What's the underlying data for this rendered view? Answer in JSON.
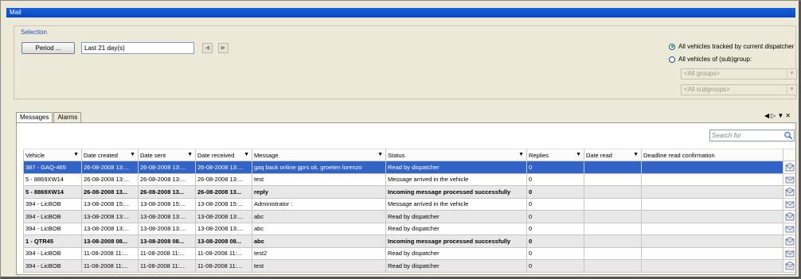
{
  "window": {
    "title": "Mail"
  },
  "selection": {
    "title": "Selection",
    "period_button": "Period ...",
    "period_value": "Last 21 day(s)",
    "radio_all_tracked": "All vehicles tracked by current dispatcher",
    "radio_subgroup": "All vehicles of (sub)group:",
    "groups_combo": "<All groups>",
    "subgroups_combo": "<All subgroups>"
  },
  "tabs": [
    {
      "label": "Messages",
      "active": true
    },
    {
      "label": "Alarms",
      "active": false
    }
  ],
  "search": {
    "placeholder": "Search for"
  },
  "table": {
    "columns": [
      "Vehicle",
      "Date created",
      "Date sent",
      "Date received",
      "Message",
      "Status",
      "Replies",
      "Date read",
      "Deadline read confirmation"
    ],
    "rows": [
      {
        "style": "sel",
        "cells": [
          "387 - GAQ-465",
          "26-08-2008 13:...",
          "26-08-2008 13:...",
          "26-08-2008 13:...",
          "gaq back online  gprs ok. groeten lorenzo",
          "Read by dispatcher",
          "0",
          "",
          ""
        ]
      },
      {
        "style": "",
        "cells": [
          "5 - 8869XW14",
          "26-08-2008 13:...",
          "26-08-2008 13:...",
          "26-08-2008 13:...",
          "test",
          "Message arrived in the vehicle",
          "0",
          "",
          ""
        ]
      },
      {
        "style": "bold alt",
        "cells": [
          "5 - 8869XW14",
          "26-08-2008 13...",
          "26-08-2008 13...",
          "26-08-2008 13...",
          "reply",
          "Incoming message processed successfully",
          "0",
          "",
          ""
        ]
      },
      {
        "style": "",
        "cells": [
          "394 - LicBOB",
          "13-08-2008 15:...",
          "13-08-2008 15:...",
          "13-08-2008 15:...",
          "Administrator  :",
          "Message arrived in the vehicle",
          "0",
          "",
          ""
        ]
      },
      {
        "style": "alt",
        "cells": [
          "394 - LicBOB",
          "13-08-2008 13:...",
          "13-08-2008 13:...",
          "13-08-2008 13:...",
          "abc",
          "Read by dispatcher",
          "0",
          "",
          ""
        ]
      },
      {
        "style": "",
        "cells": [
          "394 - LicBOB",
          "13-08-2008 13:...",
          "13-08-2008 13:...",
          "13-08-2008 13:...",
          "abc",
          "Read by dispatcher",
          "0",
          "",
          ""
        ]
      },
      {
        "style": "bold alt",
        "cells": [
          "1 - QTR45",
          "13-08-2008 08...",
          "13-08-2008 08...",
          "13-08-2008 08...",
          "abc",
          "Incoming message processed successfully",
          "0",
          "",
          ""
        ]
      },
      {
        "style": "",
        "cells": [
          "394 - LicBOB",
          "11-08-2008 11:...",
          "11-08-2008 11:...",
          "11-08-2008 11:...",
          "test2",
          "Read by dispatcher",
          "0",
          "",
          ""
        ]
      },
      {
        "style": "alt",
        "cells": [
          "394 - LicBOB",
          "11-08-2008 11:...",
          "11-08-2008 11:...",
          "11-08-2008 11:...",
          "test",
          "Read by dispatcher",
          "0",
          "",
          ""
        ]
      }
    ]
  }
}
